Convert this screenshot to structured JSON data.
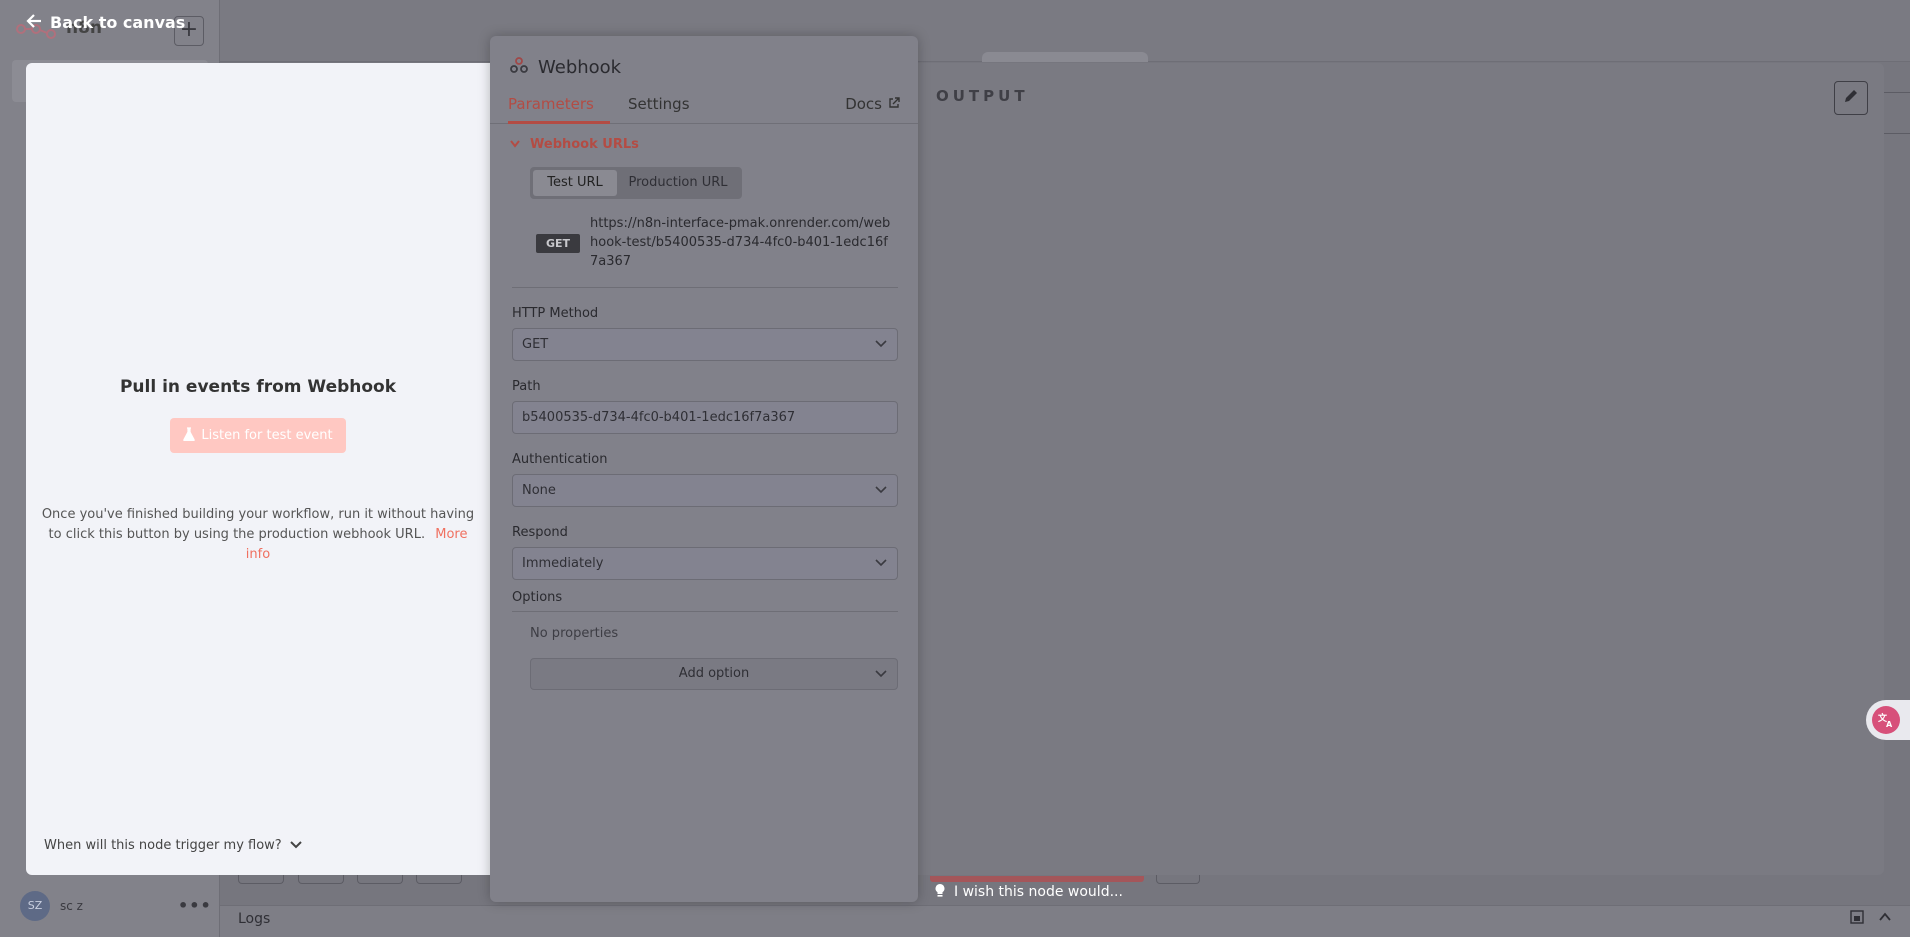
{
  "app": {
    "logo_text": "n8n",
    "add_label": "+",
    "user_initials": "SZ",
    "user_name": "sc z",
    "user_more": "•••",
    "logs_label": "Logs"
  },
  "back_link": "Back to canvas",
  "input_panel": {
    "title": "Pull in events from Webhook",
    "listen_button": "Listen for test event",
    "help_text": "Once you've finished building your workflow, run it without having to click this button by using the production webhook URL.",
    "more_info": "More info",
    "trigger_question": "When will this node trigger my flow?"
  },
  "node": {
    "title": "Webhook",
    "tabs": {
      "parameters": "Parameters",
      "settings": "Settings",
      "docs": "Docs"
    },
    "webhook_urls": {
      "section_label": "Webhook URLs",
      "test_url_label": "Test URL",
      "production_url_label": "Production URL",
      "method_badge": "GET",
      "url": "https://n8n-interface-pmak.onrender.com/webhook-test/b5400535-d734-4fc0-b401-1edc16f7a367"
    },
    "fields": {
      "http_method_label": "HTTP Method",
      "http_method_value": "GET",
      "path_label": "Path",
      "path_value": "b5400535-d734-4fc0-b401-1edc16f7a367",
      "auth_label": "Authentication",
      "auth_value": "None",
      "respond_label": "Respond",
      "respond_value": "Immediately"
    },
    "options": {
      "label": "Options",
      "empty": "No properties",
      "add_option": "Add option"
    }
  },
  "output_panel": {
    "label": "OUTPUT"
  },
  "feedback": {
    "wish": "I wish this node would..."
  },
  "colors": {
    "accent": "#ff6d5a",
    "listen_button": "#ffc8c2",
    "translate_badge": "#d7507a"
  }
}
